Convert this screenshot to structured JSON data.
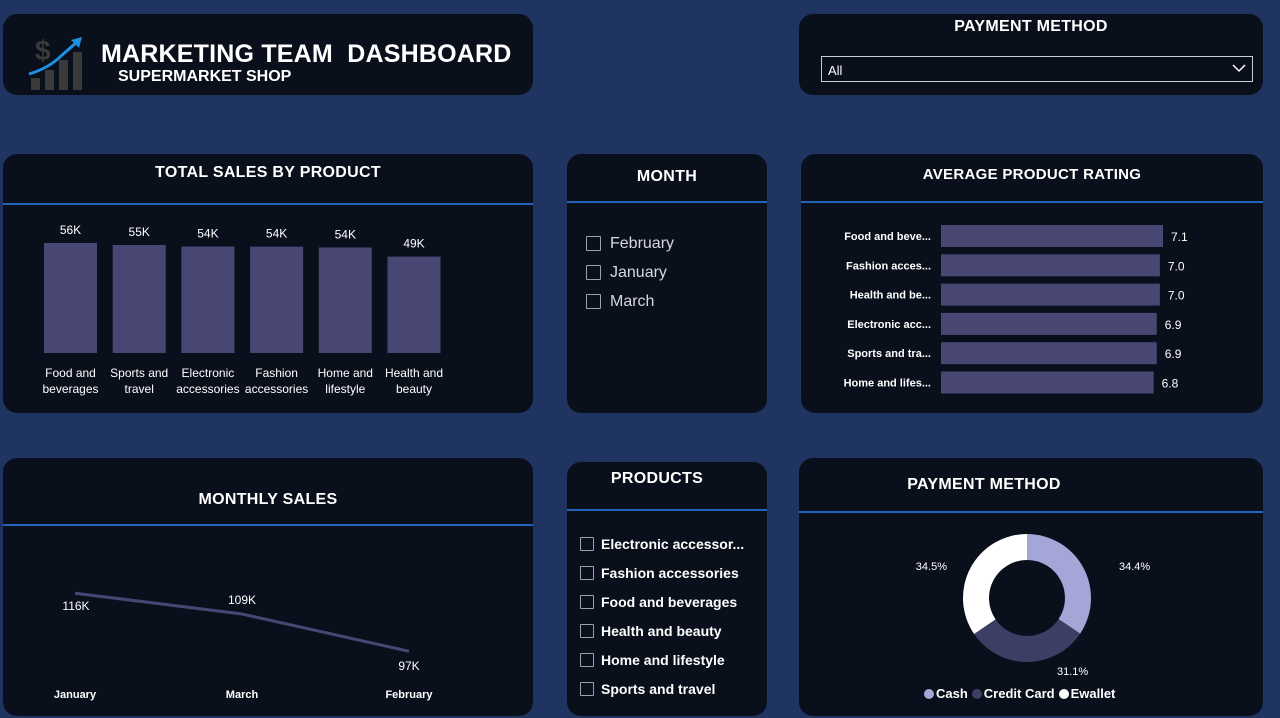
{
  "header": {
    "title": "MARKETING TEAM  DASHBOARD",
    "subtitle": "SUPERMARKET SHOP",
    "logo_icon": "dollar-growth-chart-icon"
  },
  "payment_slicer": {
    "title": "PAYMENT METHOD",
    "selected": "All",
    "chevron_icon": "chevron-down-icon"
  },
  "month_slicer": {
    "title": "MONTH",
    "options": [
      "February",
      "January",
      "March"
    ]
  },
  "products_slicer": {
    "title": "PRODUCTS",
    "options": [
      "Electronic accessor...",
      "Fashion accessories",
      "Food and beverages",
      "Health and beauty",
      "Home and lifestyle",
      "Sports and travel"
    ]
  },
  "colors": {
    "background": "#1f3461",
    "card": "#0a0f1c",
    "divider": "#2563b8",
    "bar": "#484773",
    "line": "#484773",
    "cash": "#a3a6d7",
    "credit_card": "#3d3e63",
    "ewallet": "#ffffff"
  },
  "chart_data": [
    {
      "type": "bar",
      "title": "TOTAL SALES BY PRODUCT",
      "categories": [
        "Food and beverages",
        "Sports and travel",
        "Electronic accessories",
        "Fashion accessories",
        "Home and lifestyle",
        "Health and beauty"
      ],
      "category_lines": [
        [
          "Food and",
          "beverages"
        ],
        [
          "Sports and",
          "travel"
        ],
        [
          "Electronic",
          "accessories"
        ],
        [
          "Fashion",
          "accessories"
        ],
        [
          "Home and",
          "lifestyle"
        ],
        [
          "Health and",
          "beauty"
        ]
      ],
      "values": [
        56144,
        55123,
        54338,
        54306,
        53862,
        49194
      ],
      "data_labels": [
        "56K",
        "55K",
        "54K",
        "54K",
        "54K",
        "49K"
      ],
      "ylim": [
        0,
        56144
      ]
    },
    {
      "type": "bar",
      "orientation": "horizontal",
      "title": "AVERAGE PRODUCT RATING",
      "categories": [
        "Food and beve...",
        "Fashion acces...",
        "Health and be...",
        "Electronic acc...",
        "Sports and tra...",
        "Home and lifes..."
      ],
      "values": [
        7.1,
        7.0,
        7.0,
        6.9,
        6.9,
        6.8
      ],
      "data_labels": [
        "7.1",
        "7.0",
        "7.0",
        "6.9",
        "6.9",
        "6.8"
      ],
      "xlim": [
        0,
        7.1
      ]
    },
    {
      "type": "line",
      "title": "MONTHLY SALES",
      "x": [
        "January",
        "March",
        "February"
      ],
      "values": [
        116291,
        109456,
        97219
      ],
      "data_labels": [
        "116K",
        "109K",
        "97K"
      ],
      "ylim": [
        95000,
        118000
      ]
    },
    {
      "type": "pie",
      "title": "PAYMENT METHOD",
      "labels": [
        "Cash",
        "Credit Card",
        "Ewallet"
      ],
      "values": [
        34.4,
        31.1,
        34.5
      ],
      "data_labels": [
        "34.4%",
        "31.1%",
        "34.5%"
      ],
      "legend": "bottom"
    }
  ]
}
